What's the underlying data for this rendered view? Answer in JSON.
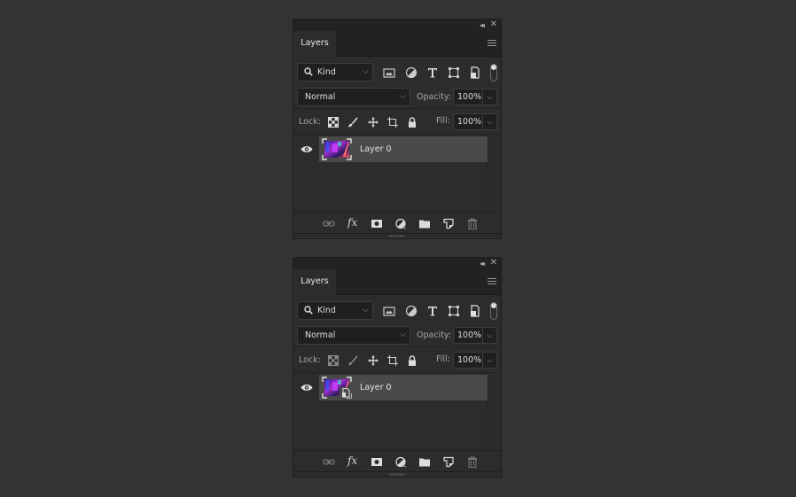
{
  "panels": [
    {
      "id": "top",
      "tab": "Layers",
      "filter": {
        "kind_label": "Kind",
        "icons": [
          "image-filter-icon",
          "adjustment-filter-icon",
          "type-filter-icon",
          "shape-filter-icon",
          "smart-object-filter-icon"
        ]
      },
      "blend_mode": "Normal",
      "opacity_label": "Opacity:",
      "opacity": "100%",
      "lock_label": "Lock:",
      "fill_label": "Fill:",
      "fill": "100%",
      "layers": [
        {
          "name": "Layer 0",
          "visible": true,
          "smart_object": false
        }
      ],
      "lock_icons": [
        "lock-transparent-pixels-icon",
        "lock-image-pixels-icon",
        "lock-position-icon",
        "lock-artboard-icon",
        "lock-all-icon"
      ],
      "footer": [
        "link-layers-icon",
        "fx-icon",
        "add-mask-icon",
        "new-adjustment-icon",
        "new-group-icon",
        "new-layer-icon",
        "delete-layer-icon"
      ]
    },
    {
      "id": "bottom",
      "tab": "Layers",
      "filter": {
        "kind_label": "Kind",
        "icons": [
          "image-filter-icon",
          "adjustment-filter-icon",
          "type-filter-icon",
          "shape-filter-icon",
          "smart-object-filter-icon"
        ]
      },
      "blend_mode": "Normal",
      "opacity_label": "Opacity:",
      "opacity": "100%",
      "lock_label": "Lock:",
      "fill_label": "Fill:",
      "fill": "100%",
      "layers": [
        {
          "name": "Layer 0",
          "visible": true,
          "smart_object": true
        }
      ],
      "lock_icons": [
        "lock-transparent-pixels-icon",
        "lock-image-pixels-icon",
        "lock-position-icon",
        "lock-artboard-icon",
        "lock-all-icon"
      ],
      "footer": [
        "link-layers-icon",
        "fx-icon",
        "add-mask-icon",
        "new-adjustment-icon",
        "new-group-icon",
        "new-layer-icon",
        "delete-layer-icon"
      ]
    }
  ],
  "icons": {
    "collapse": "◂◂",
    "close": "✕",
    "chevron": "⌵",
    "fx": "fx"
  },
  "colors": {
    "background": "#333333",
    "panel": "#2c2c2c",
    "selected_layer": "#4a4a4a"
  }
}
